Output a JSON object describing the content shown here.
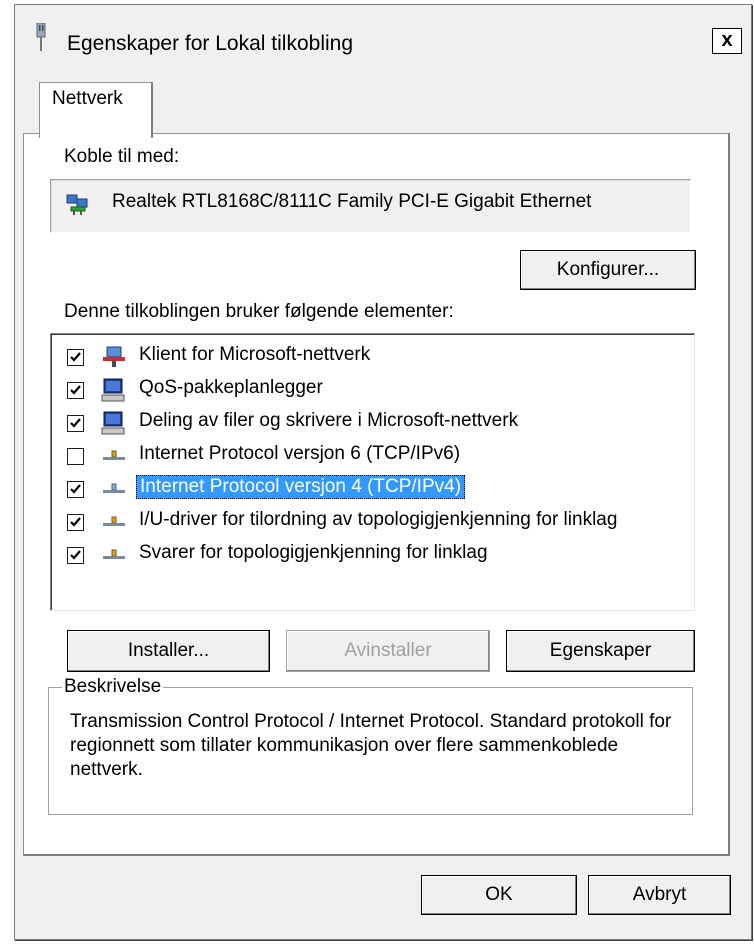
{
  "window": {
    "title": "Egenskaper for Lokal tilkobling",
    "close_label": "x"
  },
  "tabs": [
    {
      "label": "Nettverk",
      "active": true
    }
  ],
  "connect_using": {
    "label": "Koble til med:",
    "adapter": "Realtek RTL8168C/8111C Family PCI-E Gigabit Ethernet",
    "configure_button": "Konfigurer..."
  },
  "items_section": {
    "label": "Denne tilkoblingen bruker følgende elementer:",
    "items": [
      {
        "label": "Klient for Microsoft-nettverk",
        "checked": true,
        "icon": "network-client-icon",
        "selected": false
      },
      {
        "label": "QoS-pakkeplanlegger",
        "checked": true,
        "icon": "computer-service-icon",
        "selected": false
      },
      {
        "label": "Deling av filer og skrivere i Microsoft-nettverk",
        "checked": true,
        "icon": "computer-service-icon",
        "selected": false
      },
      {
        "label": "Internet Protocol versjon 6 (TCP/IPv6)",
        "checked": false,
        "icon": "protocol-icon",
        "selected": false
      },
      {
        "label": "Internet Protocol versjon 4 (TCP/IPv4)",
        "checked": true,
        "icon": "protocol-icon",
        "selected": true
      },
      {
        "label": "I/U-driver for tilordning av topologigjenkjenning for linklag",
        "checked": true,
        "icon": "protocol-icon",
        "selected": false
      },
      {
        "label": "Svarer for topologigjenkjenning for linklag",
        "checked": true,
        "icon": "protocol-icon",
        "selected": false
      }
    ]
  },
  "buttons": {
    "install": "Installer...",
    "uninstall": "Avinstaller",
    "properties": "Egenskaper",
    "ok": "OK",
    "cancel": "Avbryt"
  },
  "description": {
    "legend": "Beskrivelse",
    "text": "Transmission Control Protocol / Internet Protocol. Standard protokoll for regionnett som tillater kommunikasjon over flere sammenkoblede nettverk."
  },
  "colors": {
    "selection": "#3399ff",
    "dialog_bg": "#f0f0f0"
  }
}
